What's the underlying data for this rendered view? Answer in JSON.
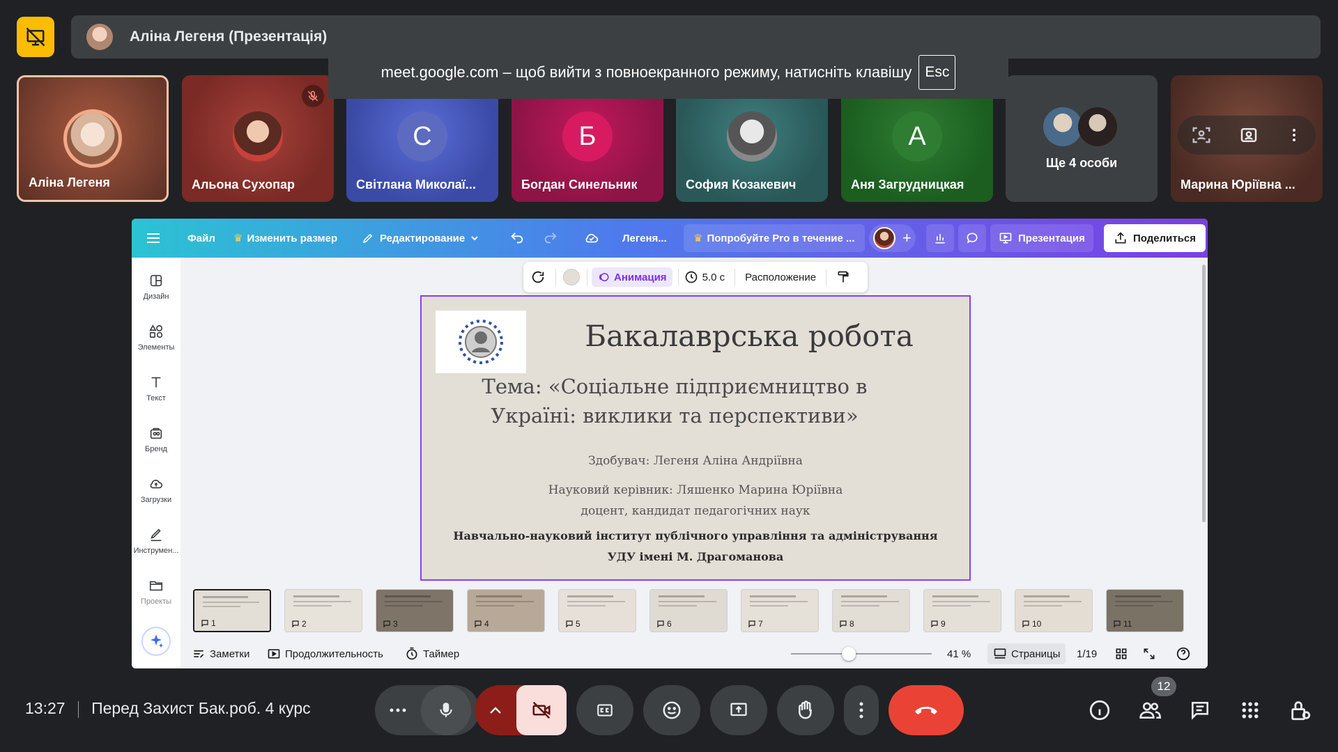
{
  "meet": {
    "presenter_label": "Аліна Легеня (Презентація)",
    "fullscreen_notice": "meet.google.com – щоб вийти з повноекранного режиму, натисніть клавішу",
    "fullscreen_key": "Esc",
    "participants": [
      {
        "name": "Аліна Легеня",
        "initial": ""
      },
      {
        "name": "Альона Сухопар",
        "initial": ""
      },
      {
        "name": "Світлана Миколаї...",
        "initial": "С"
      },
      {
        "name": "Богдан Синельник",
        "initial": "Б"
      },
      {
        "name": "София Козакевич",
        "initial": ""
      },
      {
        "name": "Аня Загрудницкая",
        "initial": "А"
      },
      {
        "name": "Ще 4 особи",
        "initial": ""
      },
      {
        "name": "Марина Юріївна ...",
        "initial": ""
      }
    ],
    "time": "13:27",
    "meeting_title": "Перед Захист Бак.роб. 4 курс",
    "people_count": "12",
    "colors": {
      "bg": "#202124",
      "bar": "#3c4043",
      "accent": "#fbbc04",
      "danger": "#ea4335",
      "cam_off": "#f9dedc"
    }
  },
  "canva": {
    "menu": {
      "file": "Файл",
      "resize": "Изменить размер",
      "editing": "Редактирование",
      "doc_name": "Легеня...",
      "pro_trial": "Попробуйте Pro в течение ...",
      "present": "Презентация",
      "share": "Поделиться"
    },
    "sidebar": [
      "Дизайн",
      "Элементы",
      "Текст",
      "Бренд",
      "Загрузки",
      "Инструмен...",
      "Проекты"
    ],
    "toolbar": {
      "animation": "Анимация",
      "duration": "5.0 с",
      "position": "Расположение"
    },
    "slide": {
      "title": "Бакалаврська робота",
      "topic_line1": "Тема: «Соціальне підприємництво в",
      "topic_line2": "Україні: виклики та перспективи»",
      "student": "Здобувач: Легеня Аліна Андріївна",
      "supervisor": "Науковий керівник: Ляшенко Марина Юріївна",
      "supervisor_title": "доцент, кандидат педагогічних наук",
      "institute": "Навчально-науковий інститут публічного управління та адміністрування",
      "university": "УДУ імені М. Драгоманова"
    },
    "thumbnails": [
      "1",
      "2",
      "3",
      "4",
      "5",
      "6",
      "7",
      "8",
      "9",
      "10",
      "11"
    ],
    "bottom": {
      "notes": "Заметки",
      "duration": "Продолжительность",
      "timer": "Таймер",
      "zoom_value": 0.41,
      "zoom": "41 %",
      "pages": "Страницы",
      "page_count": "1/19"
    },
    "colors": {
      "gradient_start": "#2bc3d3",
      "gradient_end": "#7b3fe4",
      "selection": "#8b3dff"
    }
  }
}
